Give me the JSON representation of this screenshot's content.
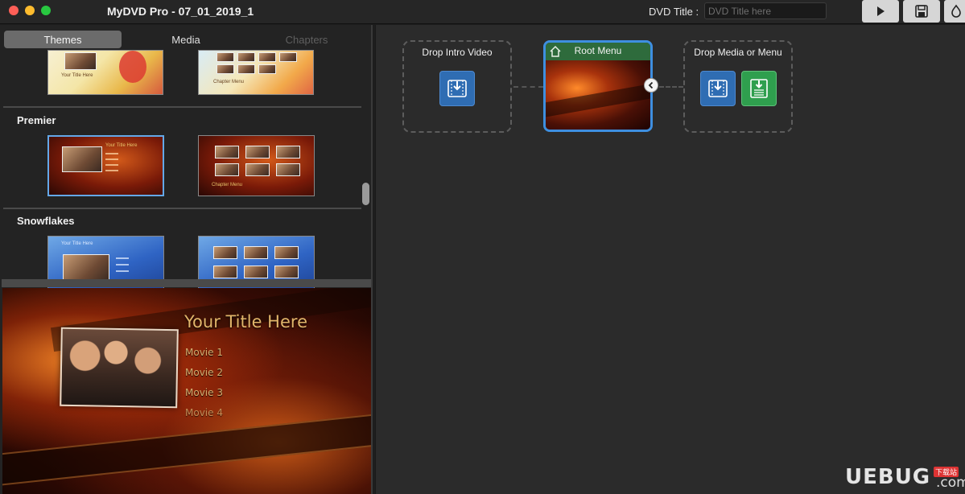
{
  "window": {
    "title": "MyDVD Pro - 07_01_2019_1",
    "dvd_title_label": "DVD Title :",
    "dvd_title_value": "",
    "dvd_title_placeholder": "DVD Title here"
  },
  "toolbar": {
    "buttons": [
      {
        "name": "play",
        "icon": "play-icon"
      },
      {
        "name": "save",
        "icon": "save-icon"
      },
      {
        "name": "burn",
        "icon": "burn-icon"
      }
    ]
  },
  "tabs": [
    {
      "label": "Themes",
      "active": true,
      "enabled": true
    },
    {
      "label": "Media",
      "active": false,
      "enabled": true
    },
    {
      "label": "Chapters",
      "active": false,
      "enabled": false
    }
  ],
  "themes": {
    "sections": [
      {
        "title": "",
        "thumbnails": [
          {
            "caption": "Your Title Here",
            "style": "birthday"
          },
          {
            "caption": "Chapter Menu",
            "style": "birthday2"
          }
        ]
      },
      {
        "title": "Premier",
        "thumbnails": [
          {
            "caption": "Your Title Here",
            "style": "premier",
            "selected": true
          },
          {
            "caption": "Chapter Menu",
            "style": "premier"
          }
        ]
      },
      {
        "title": "Snowflakes",
        "thumbnails": [
          {
            "caption": "Your Title Here",
            "style": "snow"
          },
          {
            "caption": "",
            "style": "snow"
          }
        ]
      }
    ]
  },
  "preview": {
    "title": "Your Title Here",
    "items": [
      "Movie 1",
      "Movie 2",
      "Movie 3",
      "Movie 4"
    ]
  },
  "canvas": {
    "intro": {
      "label": "Drop Intro Video",
      "icon": "drop-video-icon"
    },
    "root": {
      "label": "Root Menu",
      "icon": "home-icon"
    },
    "media": {
      "label": "Drop Media or Menu",
      "icons": [
        "drop-video-icon",
        "drop-menu-icon"
      ]
    }
  },
  "watermark": {
    "text": "UEBUG",
    "badge": "下载站",
    "suffix": ".com"
  },
  "colors": {
    "accent": "#3e8fe0",
    "root_header": "#2e6b3c",
    "drop_blue": "#2f6db3",
    "drop_green": "#2f9f4e"
  }
}
